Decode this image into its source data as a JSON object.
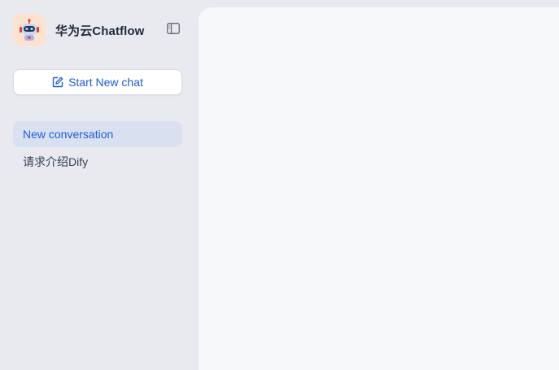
{
  "sidebar": {
    "brand": {
      "title": "华为云Chatflow",
      "logo_icon": "robot-icon"
    },
    "collapse_icon": "sidebar-toggle-icon",
    "new_chat": {
      "label": "Start New chat",
      "icon": "edit-square-icon"
    },
    "conversations": [
      {
        "label": "New conversation",
        "active": true
      },
      {
        "label": "请求介绍Dify",
        "active": false
      }
    ]
  },
  "colors": {
    "accent": "#1d5dd8",
    "sidebar_bg": "#e8eaf0",
    "active_item_bg": "#d9e1f1",
    "main_bg": "#f7f8fa",
    "logo_bg": "#fde3cf"
  }
}
